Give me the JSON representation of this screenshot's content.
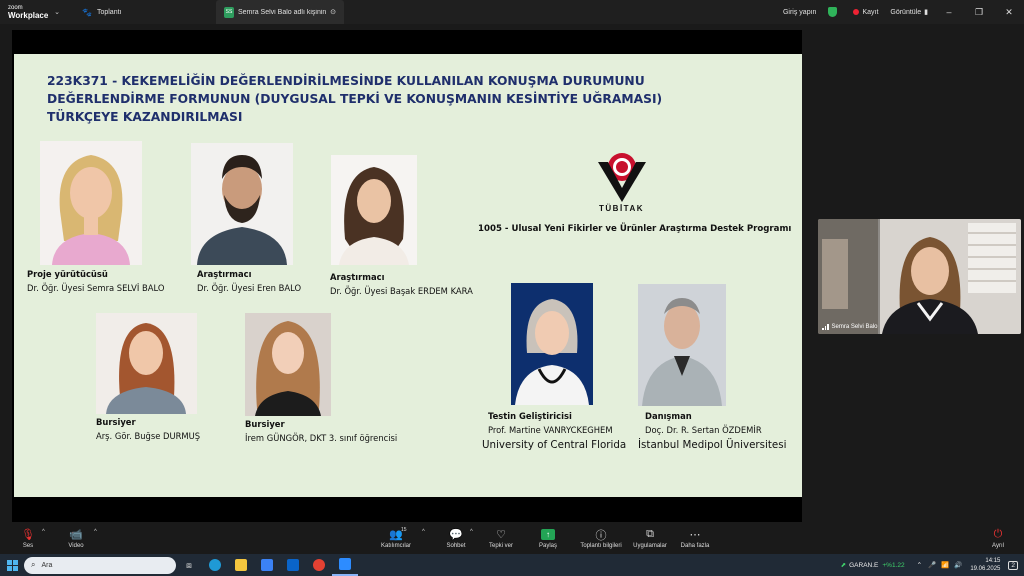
{
  "app": {
    "logo_small": "zoom",
    "logo_big": "Workplace",
    "meeting_tab": "Toplantı",
    "share_tab": "Semra Selvi Balo adlı kişinin ekranı",
    "share_badge": "SS",
    "sign_in": "Giriş yapın",
    "record": "Kayıt",
    "view": "Görüntüle"
  },
  "slide": {
    "title_line1": "223K371 - KEKEMELİĞİN DEĞERLENDİRİLMESİNDE KULLANILAN KONUŞMA DURUMUNU",
    "title_line2": "DEĞERLENDİRME FORMUNUN (DUYGUSAL TEPKİ VE KONUŞMANIN KESİNTİYE UĞRAMASI)",
    "title_line3": "TÜRKÇEYE KAZANDIRILMASI",
    "tubitak_label": "TÜBİTAK",
    "program": "1005 - Ulusal Yeni Fikirler ve Ürünler Araştırma Destek Programı",
    "people": [
      {
        "role": "Proje yürütücüsü",
        "name": "Dr. Öğr. Üyesi Semra SELVİ BALO"
      },
      {
        "role": "Araştırmacı",
        "name": "Dr. Öğr. Üyesi Eren BALO"
      },
      {
        "role": "Araştırmacı",
        "name": "Dr. Öğr. Üyesi Başak ERDEM KARA"
      },
      {
        "role": "Bursiyer",
        "name": "Arş. Gör. Buğse DURMUŞ"
      },
      {
        "role": "Bursiyer",
        "name": "İrem GÜNGÖR, DKT 3. sınıf öğrencisi"
      },
      {
        "role": "Testin Geliştiricisi",
        "name": "Prof. Martine VANRYCKEGHEM",
        "affiliation": "University of Central Florida"
      },
      {
        "role": "Danışman",
        "name": "Doç. Dr. R. Sertan ÖZDEMİR",
        "affiliation": "İstanbul Medipol Üniversitesi"
      }
    ]
  },
  "video": {
    "participant": "Semra Selvi Balo"
  },
  "controls": {
    "audio": "Ses",
    "video": "Video",
    "participants": "Katılımcılar",
    "participants_count": "15",
    "chat": "Sohbet",
    "react": "Tepki ver",
    "share": "Paylaş",
    "info": "Toplantı bilgileri",
    "apps": "Uygulamalar",
    "more": "Daha fazla",
    "leave": "Ayrıl"
  },
  "taskbar": {
    "search_placeholder": "Ara",
    "stock_name": "GARAN.E",
    "stock_change": "+%1.22",
    "time": "14:15",
    "date": "19.06.2025",
    "notifications": "2"
  }
}
